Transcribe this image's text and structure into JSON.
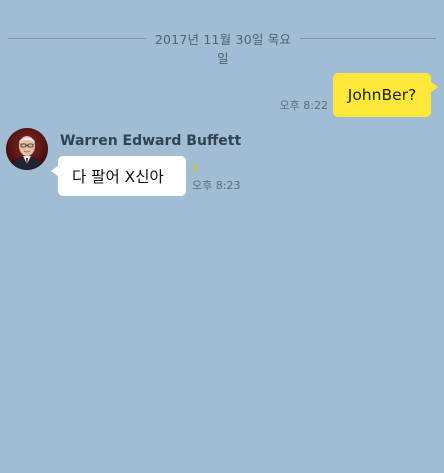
{
  "chat": {
    "date_divider": "2017년 11월 30일 목요일",
    "outgoing": {
      "text": "JohnBer?",
      "time": "오후 8:22",
      "bubble_color": "#fde83a"
    },
    "incoming": {
      "sender_name": "Warren Edward Buffett",
      "text": "다 팔어 X신아",
      "unread_count": "1",
      "time": "오후 8:23",
      "bubble_color": "#ffffff"
    },
    "background_color": "#a0bdd3",
    "avatar_icon": "person-portrait-icon"
  }
}
